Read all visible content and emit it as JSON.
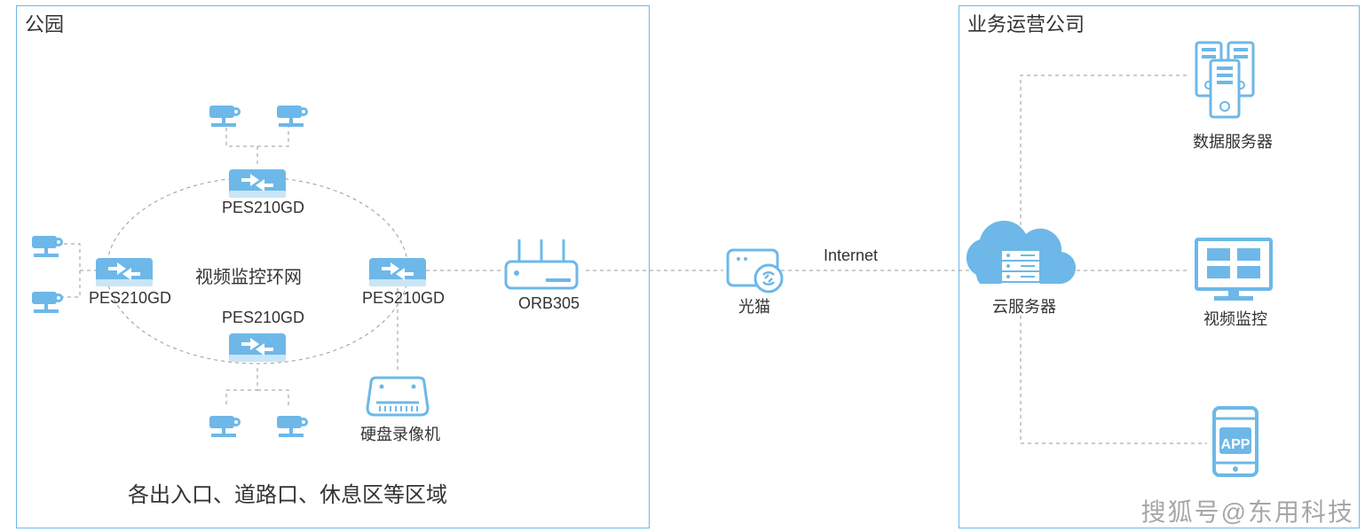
{
  "boxes": {
    "park": {
      "title": "公园"
    },
    "company": {
      "title": "业务运营公司"
    }
  },
  "labels": {
    "ringNetwork": "视频监控环网",
    "switchTop": "PES210GD",
    "switchLeft": "PES210GD",
    "switchRight": "PES210GD",
    "switchBottom": "PES210GD",
    "nvr": "硬盘录像机",
    "router": "ORB305",
    "modem": "光猫",
    "internet": "Internet",
    "cloud": "云服务器",
    "dataServer": "数据服务器",
    "videoMonitor": "视频监控",
    "app": "APP",
    "areaDesc": "各出入口、道路口、休息区等区域"
  },
  "watermark": "搜狐号@东用科技",
  "colors": {
    "line": "#6db8e8",
    "iconFill": "#6db8e8",
    "text": "#333333"
  }
}
